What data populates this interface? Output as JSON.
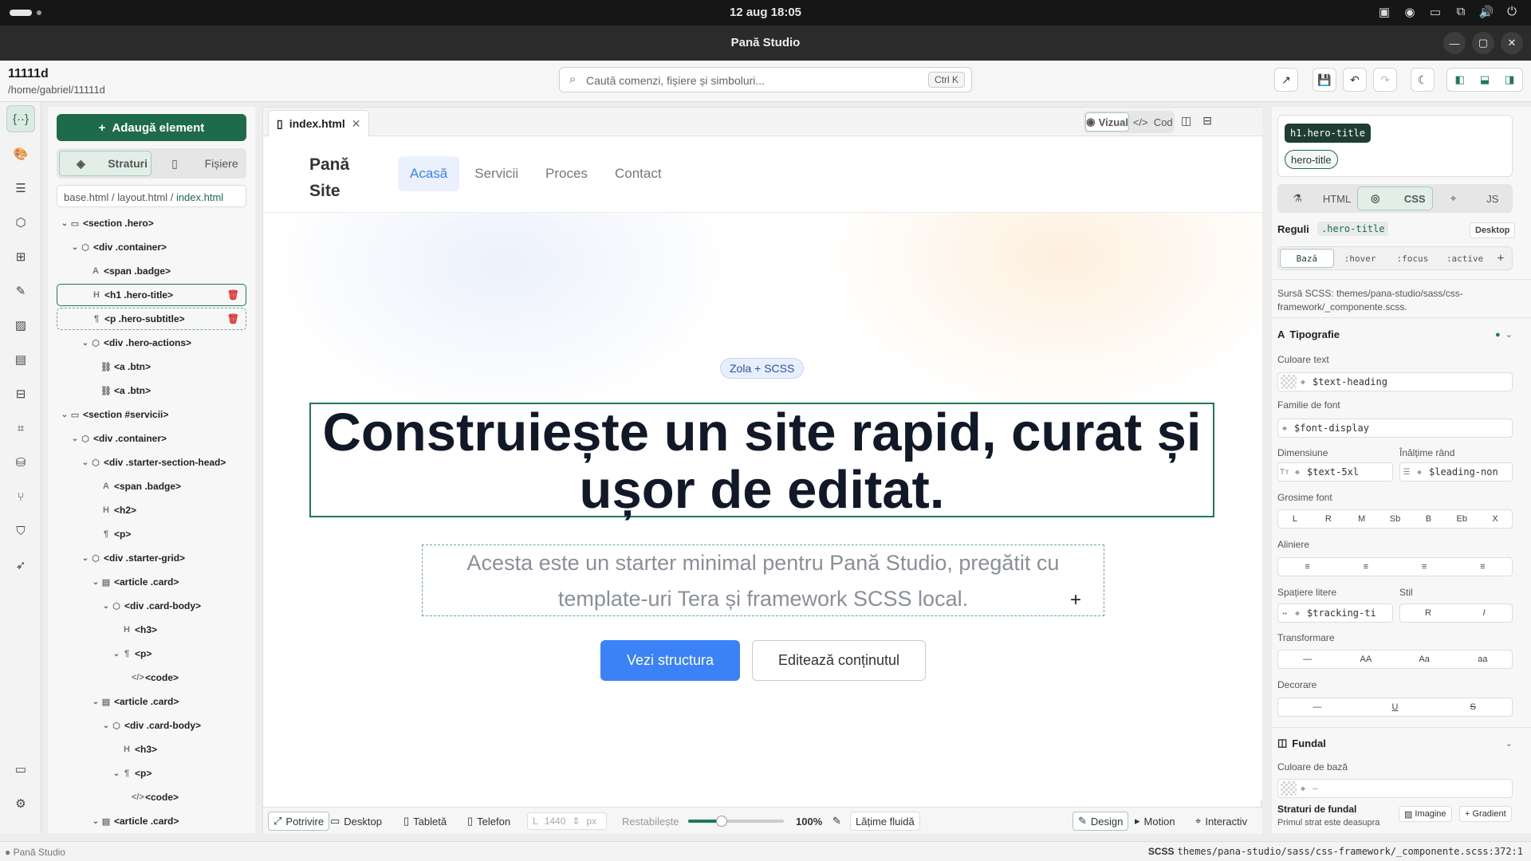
{
  "system": {
    "clock": "12 aug  18:05"
  },
  "window": {
    "title": "Pană Studio"
  },
  "project": {
    "name": "11111d",
    "path": "/home/gabriel/11111d"
  },
  "command": {
    "placeholder": "Caută comenzi, fișiere și simboluri...",
    "shortcut": "Ctrl K"
  },
  "layers_panel": {
    "add_label": "Adaugă element",
    "tabs": [
      "Straturi",
      "Fișiere"
    ],
    "breadcrumbs": [
      "base.html",
      "layout.html",
      "index.html"
    ],
    "tree": [
      {
        "label": "<section .hero>",
        "depth": 0,
        "caret": "v",
        "icon": "▭"
      },
      {
        "label": "<div .container>",
        "depth": 1,
        "caret": "v",
        "icon": "⬡"
      },
      {
        "label": "<span .badge>",
        "depth": 2,
        "caret": "",
        "icon": "A"
      },
      {
        "label": "<h1 .hero-title>",
        "depth": 2,
        "caret": "",
        "icon": "H",
        "selected": true
      },
      {
        "label": "<p .hero-subtitle>",
        "depth": 2,
        "caret": "",
        "icon": "¶",
        "hovered": true
      },
      {
        "label": "<div .hero-actions>",
        "depth": 2,
        "caret": "v",
        "icon": "⬡"
      },
      {
        "label": "<a .btn>",
        "depth": 3,
        "caret": "",
        "icon": "⛓"
      },
      {
        "label": "<a .btn>",
        "depth": 3,
        "caret": "",
        "icon": "⛓"
      },
      {
        "label": "<section #servicii>",
        "depth": 0,
        "caret": "v",
        "icon": "▭"
      },
      {
        "label": "<div .container>",
        "depth": 1,
        "caret": "v",
        "icon": "⬡"
      },
      {
        "label": "<div .starter-section-head>",
        "depth": 2,
        "caret": "v",
        "icon": "⬡"
      },
      {
        "label": "<span .badge>",
        "depth": 3,
        "caret": "",
        "icon": "A"
      },
      {
        "label": "<h2>",
        "depth": 3,
        "caret": "",
        "icon": "H"
      },
      {
        "label": "<p>",
        "depth": 3,
        "caret": "",
        "icon": "¶"
      },
      {
        "label": "<div .starter-grid>",
        "depth": 2,
        "caret": "v",
        "icon": "⬡"
      },
      {
        "label": "<article .card>",
        "depth": 3,
        "caret": "v",
        "icon": "▤"
      },
      {
        "label": "<div .card-body>",
        "depth": 4,
        "caret": "v",
        "icon": "⬡"
      },
      {
        "label": "<h3>",
        "depth": 5,
        "caret": "",
        "icon": "H"
      },
      {
        "label": "<p>",
        "depth": 5,
        "caret": "v",
        "icon": "¶"
      },
      {
        "label": "<code>",
        "depth": 6,
        "caret": "",
        "icon": "</>"
      },
      {
        "label": "<article .card>",
        "depth": 3,
        "caret": "v",
        "icon": "▤"
      },
      {
        "label": "<div .card-body>",
        "depth": 4,
        "caret": "v",
        "icon": "⬡"
      },
      {
        "label": "<h3>",
        "depth": 5,
        "caret": "",
        "icon": "H"
      },
      {
        "label": "<p>",
        "depth": 5,
        "caret": "v",
        "icon": "¶"
      },
      {
        "label": "<code>",
        "depth": 6,
        "caret": "",
        "icon": "</>"
      },
      {
        "label": "<article .card>",
        "depth": 3,
        "caret": "v",
        "icon": "▤"
      }
    ]
  },
  "editor": {
    "file_tab": "index.html",
    "view_modes": [
      "Vizual",
      "Cod"
    ],
    "preview": {
      "logo": "Pană Site",
      "nav": [
        "Acasă",
        "Servicii",
        "Proces",
        "Contact"
      ],
      "badge": "Zola + SCSS",
      "title": "Construiește un site rapid, curat și ușor de editat.",
      "subtitle": "Acesta este un starter minimal pentru Pană Studio, pregătit cu template-uri Tera și framework SCSS local.",
      "primary_btn": "Vezi structura",
      "secondary_btn": "Editează conținutul"
    },
    "bottom": {
      "fit": "Potrivire",
      "devices": [
        "Desktop",
        "Tabletă",
        "Telefon"
      ],
      "width_label": "L",
      "width_value": "1440",
      "width_unit": "px",
      "reset": "Restabilește",
      "zoom": "100%",
      "zoom_fraction": 0.35,
      "fluid": "Lățime fluidă",
      "modes": [
        "Design",
        "Motion",
        "Interactiv"
      ]
    }
  },
  "inspector": {
    "selector": "h1.hero-title",
    "class_chip": "hero-title",
    "tabs": [
      "HTML",
      "CSS",
      "JS"
    ],
    "rules_label": "Reguli",
    "rule_class": ".hero-title",
    "breakpoint": "Desktop",
    "states": [
      "Bază",
      ":hover",
      ":focus",
      ":active"
    ],
    "scss_source": "Sursă SCSS: themes/pana-studio/sass/css-framework/_componente.scss.",
    "typography": {
      "heading": "Tipografie",
      "color_label": "Culoare text",
      "color_value": "$text-heading",
      "family_label": "Familie de font",
      "family_value": "$font-display",
      "size_label": "Dimensiune",
      "size_value": "$text-5xl",
      "line_label": "Înălțime rând",
      "line_value": "$leading-non",
      "weight_label": "Grosime font",
      "weights": [
        "L",
        "R",
        "M",
        "Sb",
        "B",
        "Eb",
        "X"
      ],
      "align_label": "Aliniere",
      "spacing_label": "Spațiere litere",
      "spacing_value": "$tracking-ti",
      "style_label": "Stil",
      "styles": [
        "R",
        "I"
      ],
      "transform_label": "Transformare",
      "transforms": [
        "—",
        "AA",
        "Aa",
        "aa"
      ],
      "decor_label": "Decorare",
      "decors": [
        "—",
        "U",
        "S"
      ]
    },
    "background": {
      "heading": "Fundal",
      "base_label": "Culoare de bază",
      "base_value": "–",
      "layers_label": "Straturi de fundal",
      "layers_hint": "Primul strat este deasupra",
      "image_btn": "Imagine",
      "gradient_btn": "Gradient"
    }
  },
  "statusbar": {
    "app": "Pană Studio",
    "lang": "SCSS",
    "file": "themes/pana-studio/sass/css-framework/_componente.scss:372:1"
  },
  "colors": {
    "accent": "#1e6b4c",
    "preview_blue": "#3b82f6",
    "title": "#111827"
  }
}
